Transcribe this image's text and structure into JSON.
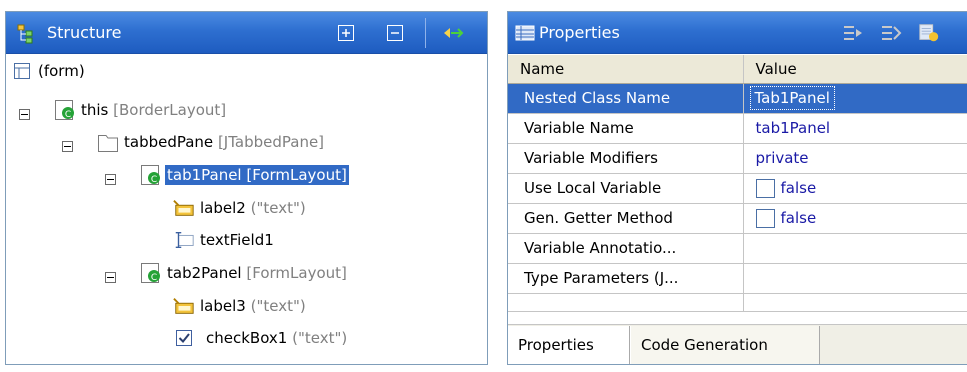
{
  "structure": {
    "title": "Structure",
    "nodes": [
      {
        "label": "(form)",
        "hint": ""
      },
      {
        "label": "this",
        "hint": " [BorderLayout]"
      },
      {
        "label": "tabbedPane",
        "hint": " [JTabbedPane]"
      },
      {
        "label": "tab1Panel [FormLayout]",
        "hint": ""
      },
      {
        "label": "label2",
        "hint": " (\"text\")"
      },
      {
        "label": "textField1",
        "hint": ""
      },
      {
        "label": "tab2Panel",
        "hint": " [FormLayout]"
      },
      {
        "label": "label3",
        "hint": " (\"text\")"
      },
      {
        "label": "checkBox1",
        "hint": " (\"text\")"
      }
    ]
  },
  "properties": {
    "title": "Properties",
    "columns": {
      "name": "Name",
      "value": "Value"
    },
    "rows": [
      {
        "name": "Nested Class Name",
        "value": "Tab1Panel"
      },
      {
        "name": "Variable Name",
        "value": "tab1Panel"
      },
      {
        "name": "Variable Modifiers",
        "value": "private"
      },
      {
        "name": "Use Local Variable",
        "value": "false"
      },
      {
        "name": "Gen. Getter Method",
        "value": "false"
      },
      {
        "name": "Variable Annotatio...",
        "value": ""
      },
      {
        "name": "Type Parameters (J...",
        "value": ""
      },
      {
        "name": "",
        "value": ""
      }
    ],
    "tabs": [
      "Properties",
      "Code Generation"
    ]
  }
}
